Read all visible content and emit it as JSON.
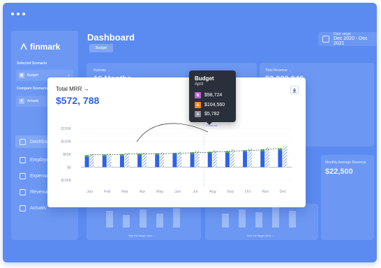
{
  "window": {
    "title": "Dashboard",
    "scenario_badge": "Budget"
  },
  "sidebar": {
    "logo": "finmark",
    "selected_scenario_label": "Selected Scenario",
    "selected_scenario_value": "Budget",
    "compare_scenario_label": "Compare Scenario",
    "compare_scenario_value": "Actuals",
    "compare_scenario_key": "A",
    "items": [
      {
        "label": "Dashboard",
        "icon": "dashboard-icon"
      },
      {
        "label": "Employees",
        "icon": "employees-icon"
      },
      {
        "label": "Expenses",
        "icon": "expenses-icon"
      },
      {
        "label": "Revenue",
        "icon": "revenue-icon"
      },
      {
        "label": "Actuals",
        "icon": "actuals-icon"
      }
    ]
  },
  "date_range": {
    "label": "Date range",
    "value": "Dec 2020 - Dec 2021"
  },
  "bg_cards": {
    "runway": {
      "title": "Runway →",
      "value": "16 Months"
    },
    "revenue": {
      "title": "Total Revenue →",
      "value": "$2,028,946"
    },
    "arpa": {
      "title": "Monthly Average Revenue",
      "value": "$22,500"
    },
    "see_report": "See the larger view →"
  },
  "mrr_card": {
    "title": "Total MRR",
    "arrow": "→",
    "amount": "$572, 788",
    "download_icon": "download-icon"
  },
  "tooltip": {
    "title": "Budget",
    "subtitle": "April",
    "rows": [
      {
        "key": "B",
        "value": "$98,724",
        "color": "#c75fd9"
      },
      {
        "key": "A",
        "value": "$104,560",
        "color": "#f08a24"
      },
      {
        "key": "Δ",
        "value": "$5,782",
        "color": "#8a8f9c"
      }
    ],
    "forecast_label": "Forecast"
  },
  "colors": {
    "bg": "#5b8bf0",
    "bar": "#2f63e6",
    "bar_alt": "#6f92e8",
    "green": "#3fae49",
    "accent_text": "#2f63e6"
  },
  "chart_data": {
    "type": "bar",
    "categories": [
      "Jan",
      "Feb",
      "Mar",
      "Apr",
      "May",
      "Jun",
      "Jul",
      "Aug",
      "Sep",
      "Oct",
      "Nov",
      "Dec"
    ],
    "y_ticks": [
      "$150K",
      "$100K",
      "$50K",
      "$0",
      "$100K"
    ],
    "ylim": [
      -50,
      150
    ],
    "series": [
      {
        "name": "Budget",
        "values": [
          42,
          44,
          46,
          47,
          49,
          51,
          54,
          57,
          60,
          64,
          68,
          72
        ]
      },
      {
        "name": "Actuals",
        "values": [
          41,
          43,
          44,
          47,
          48,
          50,
          52,
          54,
          56,
          60,
          63,
          66
        ]
      }
    ],
    "line": [
      48,
      48,
      50,
      52,
      52,
      54,
      56,
      58,
      62,
      64,
      68,
      74
    ],
    "forecast_start_index": 7
  }
}
